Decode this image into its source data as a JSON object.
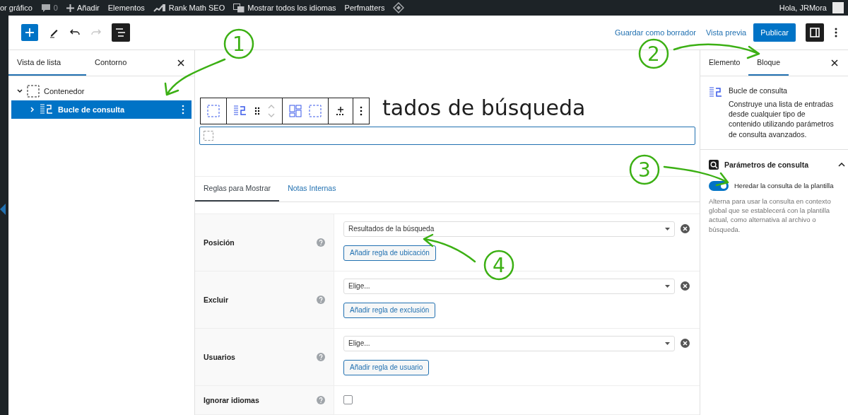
{
  "admin_bar": {
    "items": [
      {
        "kind": "text",
        "label": "or gráfico"
      },
      {
        "kind": "comments",
        "label": "0"
      },
      {
        "kind": "add",
        "label": "Añadir"
      },
      {
        "kind": "text",
        "label": "Elementos"
      },
      {
        "kind": "rankmath",
        "label": "Rank Math SEO"
      },
      {
        "kind": "languages",
        "label": "Mostrar todos los idiomas"
      },
      {
        "kind": "text",
        "label": "Perfmatters"
      },
      {
        "kind": "diamond"
      }
    ],
    "greeting": "Hola, JRMora"
  },
  "toolbar": {
    "save_draft": "Guardar como borrador",
    "preview": "Vista previa",
    "publish": "Publicar"
  },
  "list_view": {
    "tabs": [
      {
        "label": "Vista de lista",
        "selected": true
      },
      {
        "label": "Contorno",
        "selected": false
      }
    ],
    "tree": [
      {
        "label": "Contenedor",
        "expanded": true,
        "selected": false,
        "children": [
          {
            "label": "Bucle de consulta",
            "expanded": false,
            "selected": true
          }
        ]
      }
    ]
  },
  "canvas": {
    "title_visible": "tados de búsqueda",
    "tabs": [
      {
        "label": "Reglas para Mostrar",
        "selected": true
      },
      {
        "label": "Notas Internas",
        "selected": false
      }
    ],
    "rules": [
      {
        "label": "Posición",
        "kind": "select",
        "value": "Resultados de la búsqueda",
        "button": "Añadir regla de ubicación"
      },
      {
        "label": "Excluir",
        "kind": "select",
        "value": "Elige...",
        "button": "Añadir regla de exclusión"
      },
      {
        "label": "Usuarios",
        "kind": "select",
        "value": "Elige...",
        "button": "Añadir regla de usuario"
      },
      {
        "label": "Ignorar idiomas",
        "kind": "checkbox",
        "checked": false
      }
    ]
  },
  "sidebar": {
    "tabs": [
      {
        "label": "Elemento",
        "selected": false
      },
      {
        "label": "Bloque",
        "selected": true
      }
    ],
    "block": {
      "name": "Bucle de consulta",
      "description": "Construye una lista de entradas desde cualquier tipo de contenido utilizando parámetros de consulta avanzados."
    },
    "panel": {
      "title": "Parámetros de consulta",
      "expanded": true,
      "toggle": {
        "label": "Heredar la consulta de la plantilla",
        "on": true
      },
      "help": "Alterna para usar la consulta en contexto global que se establecerá con la plantilla actual, como alternativa al archivo o búsqueda."
    }
  },
  "annotations": [
    {
      "number": "1"
    },
    {
      "number": "2"
    },
    {
      "number": "3"
    },
    {
      "number": "4"
    }
  ]
}
